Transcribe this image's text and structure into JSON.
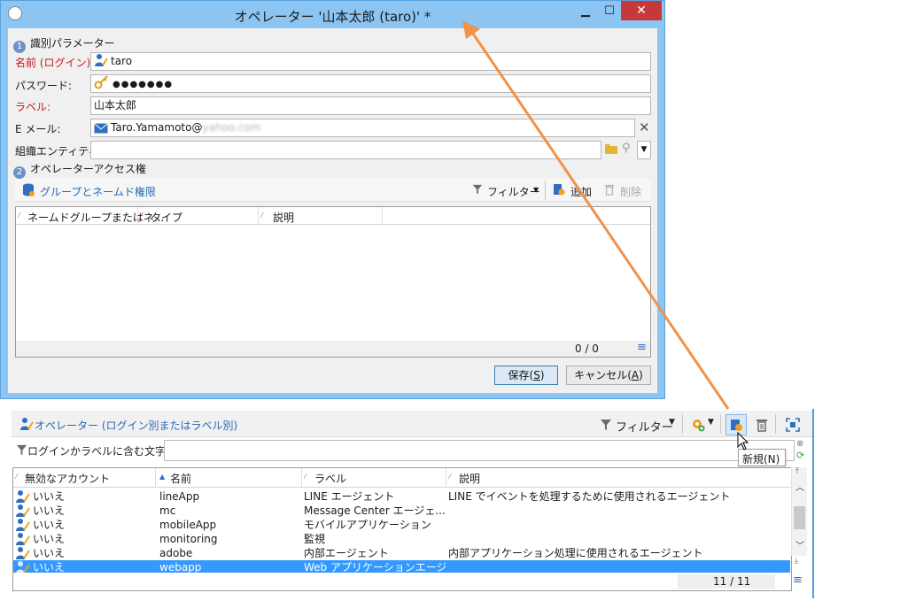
{
  "dialog": {
    "title": "オペレーター '山本太郎 (taro)' *",
    "section1": {
      "num": "1",
      "title": "識別パラメーター"
    },
    "fields": {
      "name_label": "名前 (ログイン):",
      "name_value": "taro",
      "password_label": "パスワード:",
      "password_value": "●●●●●●●",
      "label_label": "ラベル:",
      "label_value": "山本太郎",
      "email_label": "E メール:",
      "email_value": "Taro.Yamamoto@",
      "email_domain_blurred": "yahoo.com",
      "org_label": "組織エンティティ:",
      "org_value": ""
    },
    "section2": {
      "num": "2",
      "title": "オペレーターアクセス権"
    },
    "access_toolbar": {
      "title": "グループとネームド権限",
      "filter_label": "フィルター",
      "add_label": "追加",
      "delete_label": "削除"
    },
    "access_grid": {
      "columns": [
        "ネームドグループまたはネ...",
        "タイプ",
        "説明"
      ],
      "count": "0 / 0"
    },
    "save_label": "保存(",
    "save_key": "S",
    "cancel_label": "キャンセル(",
    "cancel_key": "A",
    "close_paren": ")"
  },
  "list_panel": {
    "title": "オペレーター (ログイン別またはラベル別)",
    "filter_label": "フィルター",
    "search_label": "ログインかラベルに含む文字:",
    "search_value": "",
    "tooltip": "新規(N)",
    "columns": [
      "無効なアカウント",
      "名前",
      "ラベル",
      "説明"
    ],
    "rows": [
      {
        "disabled": "いいえ",
        "name": "lineApp",
        "label": "LINE エージェント",
        "desc": "LINE でイベントを処理するために使用されるエージェント"
      },
      {
        "disabled": "いいえ",
        "name": "mc",
        "label": "Message Center エージェ...",
        "desc": ""
      },
      {
        "disabled": "いいえ",
        "name": "mobileApp",
        "label": "モバイルアプリケーション",
        "desc": ""
      },
      {
        "disabled": "いいえ",
        "name": "monitoring",
        "label": "監視",
        "desc": ""
      },
      {
        "disabled": "いいえ",
        "name": "adobe",
        "label": "内部エージェント",
        "desc": "内部アプリケーション処理に使用されるエージェント"
      },
      {
        "disabled": "いいえ",
        "name": "webapp",
        "label": "Web アプリケーションエージェ...",
        "desc": ""
      }
    ],
    "count": "11 / 11"
  },
  "colors": {
    "titlebar": "#8cc4f2",
    "accent_blue": "#2a67b2",
    "selection": "#3399ff",
    "arrow": "#f0924a",
    "required_red": "#c41a1a"
  }
}
